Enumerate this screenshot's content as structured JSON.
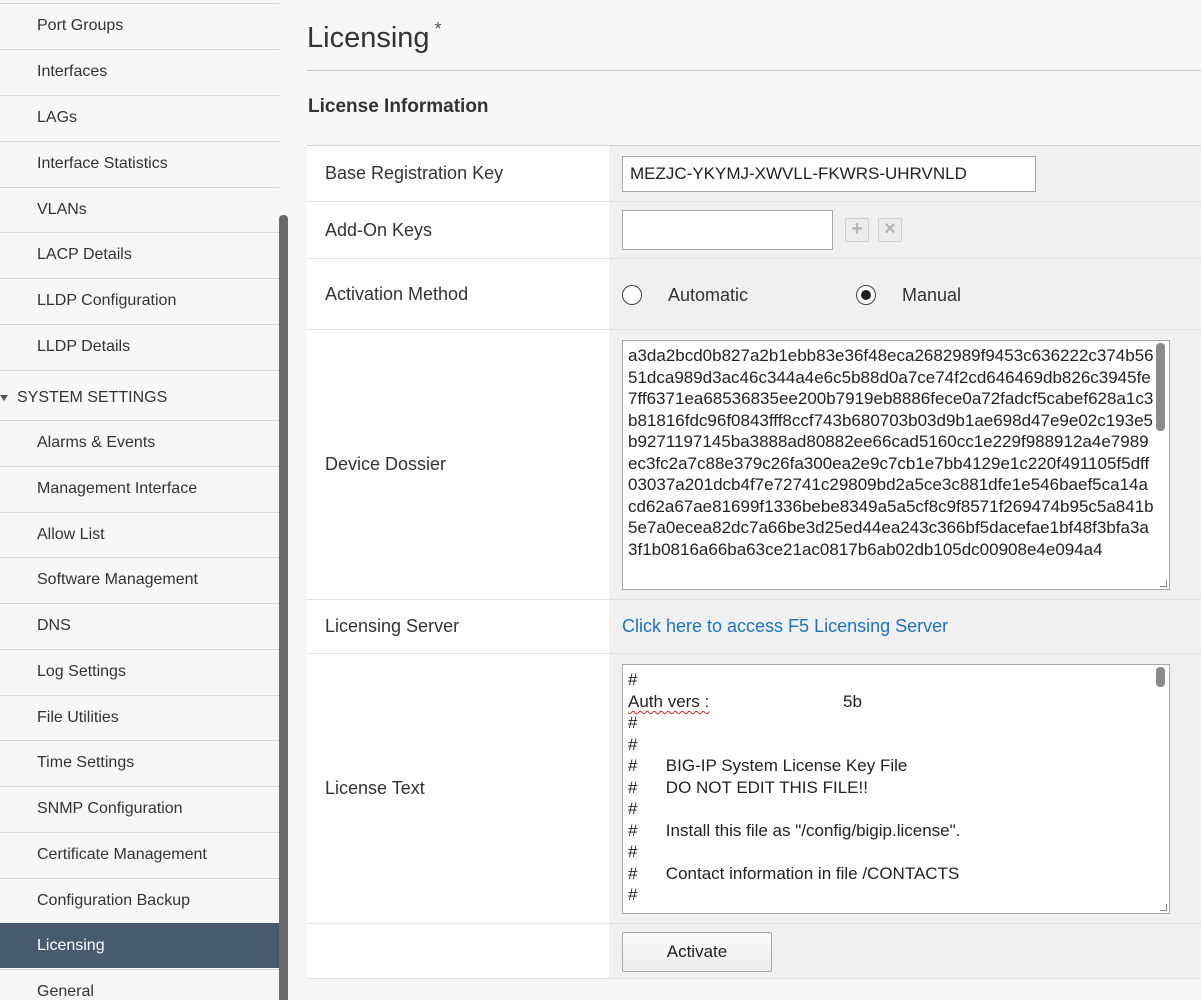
{
  "sidebar": {
    "items": [
      {
        "label": "Port Groups"
      },
      {
        "label": "Interfaces"
      },
      {
        "label": "LAGs"
      },
      {
        "label": "Interface Statistics"
      },
      {
        "label": "VLANs"
      },
      {
        "label": "LACP Details"
      },
      {
        "label": "LLDP Configuration"
      },
      {
        "label": "LLDP Details"
      },
      {
        "label": "SYSTEM SETTINGS"
      },
      {
        "label": "Alarms & Events"
      },
      {
        "label": "Management Interface"
      },
      {
        "label": "Allow List"
      },
      {
        "label": "Software Management"
      },
      {
        "label": "DNS"
      },
      {
        "label": "Log Settings"
      },
      {
        "label": "File Utilities"
      },
      {
        "label": "Time Settings"
      },
      {
        "label": "SNMP Configuration"
      },
      {
        "label": "Certificate Management"
      },
      {
        "label": "Configuration Backup"
      },
      {
        "label": "Licensing"
      },
      {
        "label": "General"
      }
    ],
    "active_item": "Licensing"
  },
  "page": {
    "title": "Licensing",
    "title_marker": "*",
    "section_title": "License Information"
  },
  "form": {
    "base_key": {
      "label": "Base Registration Key",
      "value": "MEZJC-YKYMJ-XWVLL-FKWRS-UHRVNLD"
    },
    "addon_keys": {
      "label": "Add-On Keys",
      "value": "",
      "add_glyph": "+",
      "remove_glyph": "×"
    },
    "activation": {
      "label": "Activation Method",
      "options": [
        "Automatic",
        "Manual"
      ],
      "selected": "Manual"
    },
    "dossier": {
      "label": "Device Dossier",
      "value": "a3da2bcd0b827a2b1ebb83e36f48eca2682989f9453c636222c374b5651dca989d3ac46c344a4e6c5b88d0a7ce74f2cd646469db826c3945fe7ff6371ea68536835ee200b7919eb8886fece0a72fadcf5cabef628a1c3b81816fdc96f0843fff8ccf743b680703b03d9b1ae698d47e9e02c193e5b9271197145ba3888ad80882ee66cad5160cc1e229f988912a4e7989ec3fc2a7c88e379c26fa300ea2e9c7cb1e7bb4129e1c220f491105f5dff03037a201dcb4f7e72741c29809bd2a5ce3c881dfe1e546baef5ca14acd62a67ae81699f1336bebe8349a5a5cf8c9f8571f269474b95c5a841b5e7a0ecea82dc7a66be3d25ed44ea243c366bf5dacefae1bf48f3bfa3a3f1b0816a66ba63ce21ac0817b6ab02db105dc00908e4e094a4"
    },
    "licensing_server": {
      "label": "Licensing Server",
      "link_text": "Click here to access F5 Licensing Server"
    },
    "license_text": {
      "label": "License Text",
      "lines": [
        "#",
        "Auth vers :",
        "5b",
        "#",
        "#",
        "#      BIG-IP System License Key File",
        "#      DO NOT EDIT THIS FILE!!",
        "#",
        "#      Install this file as \"/config/bigip.license\".",
        "#",
        "#      Contact information in file /CONTACTS",
        "#"
      ]
    },
    "activate_button": "Activate"
  }
}
